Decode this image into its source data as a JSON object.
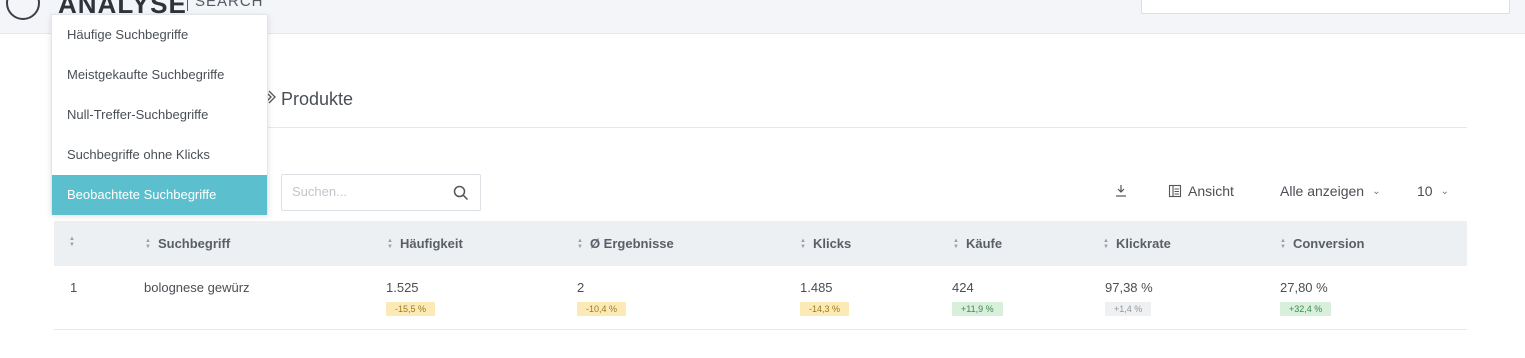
{
  "header": {
    "logo_text": "ANALYSE",
    "logo_sub": "SEARCH"
  },
  "breadcrumb": {
    "current": "Produkte"
  },
  "menu": {
    "items": [
      {
        "label": "Häufige Suchbegriffe",
        "active": false
      },
      {
        "label": "Meistgekaufte Suchbegriffe",
        "active": false
      },
      {
        "label": "Null-Treffer-Suchbegriffe",
        "active": false
      },
      {
        "label": "Suchbegriffe ohne Klicks",
        "active": false
      },
      {
        "label": "Beobachtete Suchbegriffe",
        "active": true
      }
    ]
  },
  "search": {
    "placeholder": "Suchen..."
  },
  "toolbar": {
    "view_label": "Ansicht",
    "show_all_label": "Alle anzeigen",
    "per_page": "10"
  },
  "table": {
    "columns": [
      "Suchbegriff",
      "Häufigkeit",
      "Ø Ergebnisse",
      "Klicks",
      "Käufe",
      "Klickrate",
      "Conversion"
    ],
    "rows": [
      {
        "index": "1",
        "term": "bolognese gewürz",
        "frequency": "1.525",
        "frequency_change": "-15,5 %",
        "results": "2",
        "results_change": "-10,4 %",
        "clicks": "1.485",
        "clicks_change": "-14,3 %",
        "purchases": "424",
        "purchases_change": "+11,9 %",
        "click_rate": "97,38 %",
        "click_rate_change": "+1,4 %",
        "conversion": "27,80 %",
        "conversion_change": "+32,4 %"
      }
    ]
  },
  "colors": {
    "accent": "#5bbfce",
    "negative_badge": "#fbeab6",
    "positive_badge": "#d7efdb",
    "neutral_badge": "#eef0f2"
  }
}
